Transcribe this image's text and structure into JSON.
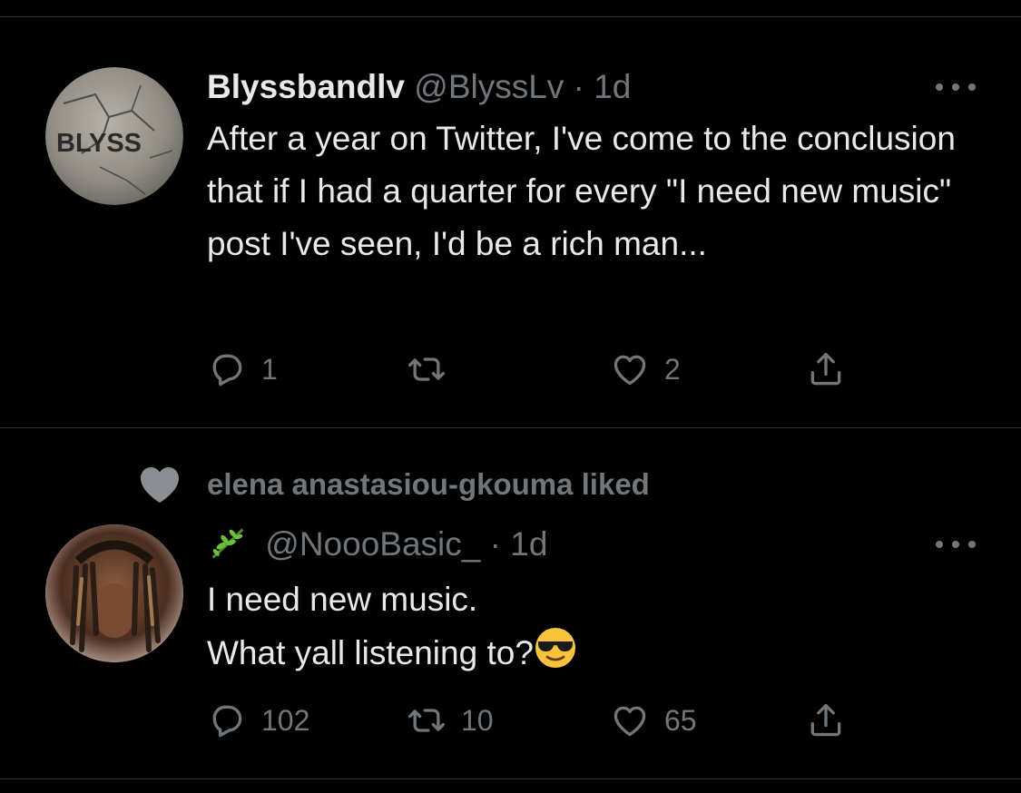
{
  "tweets": [
    {
      "display_name": "Blyssbandlv",
      "handle": "@BlyssLv",
      "separator": " · ",
      "time": "1d",
      "avatar_label": "BLYSS",
      "text": "After a year on Twitter, I've come to the conclusion that if I had a quarter for every \"I need new music\" post I've seen, I'd be a rich man...",
      "reply_count": "1",
      "retweet_count": "",
      "like_count": "2"
    },
    {
      "context_text": "elena anastasiou-gkouma liked",
      "handle": "@NoooBasic_",
      "separator": " · ",
      "time": "1d",
      "display_name_icon": "herb-emoji-icon",
      "text_line1": "I need new music.",
      "text_line2": "What yall listening to?",
      "text_emoji": "smiling-face-with-sunglasses-icon",
      "reply_count": "102",
      "retweet_count": "10",
      "like_count": "65"
    }
  ],
  "colors": {
    "background": "#000000",
    "text": "#e7e9ea",
    "muted": "#71767b",
    "divider": "#2f3336"
  }
}
